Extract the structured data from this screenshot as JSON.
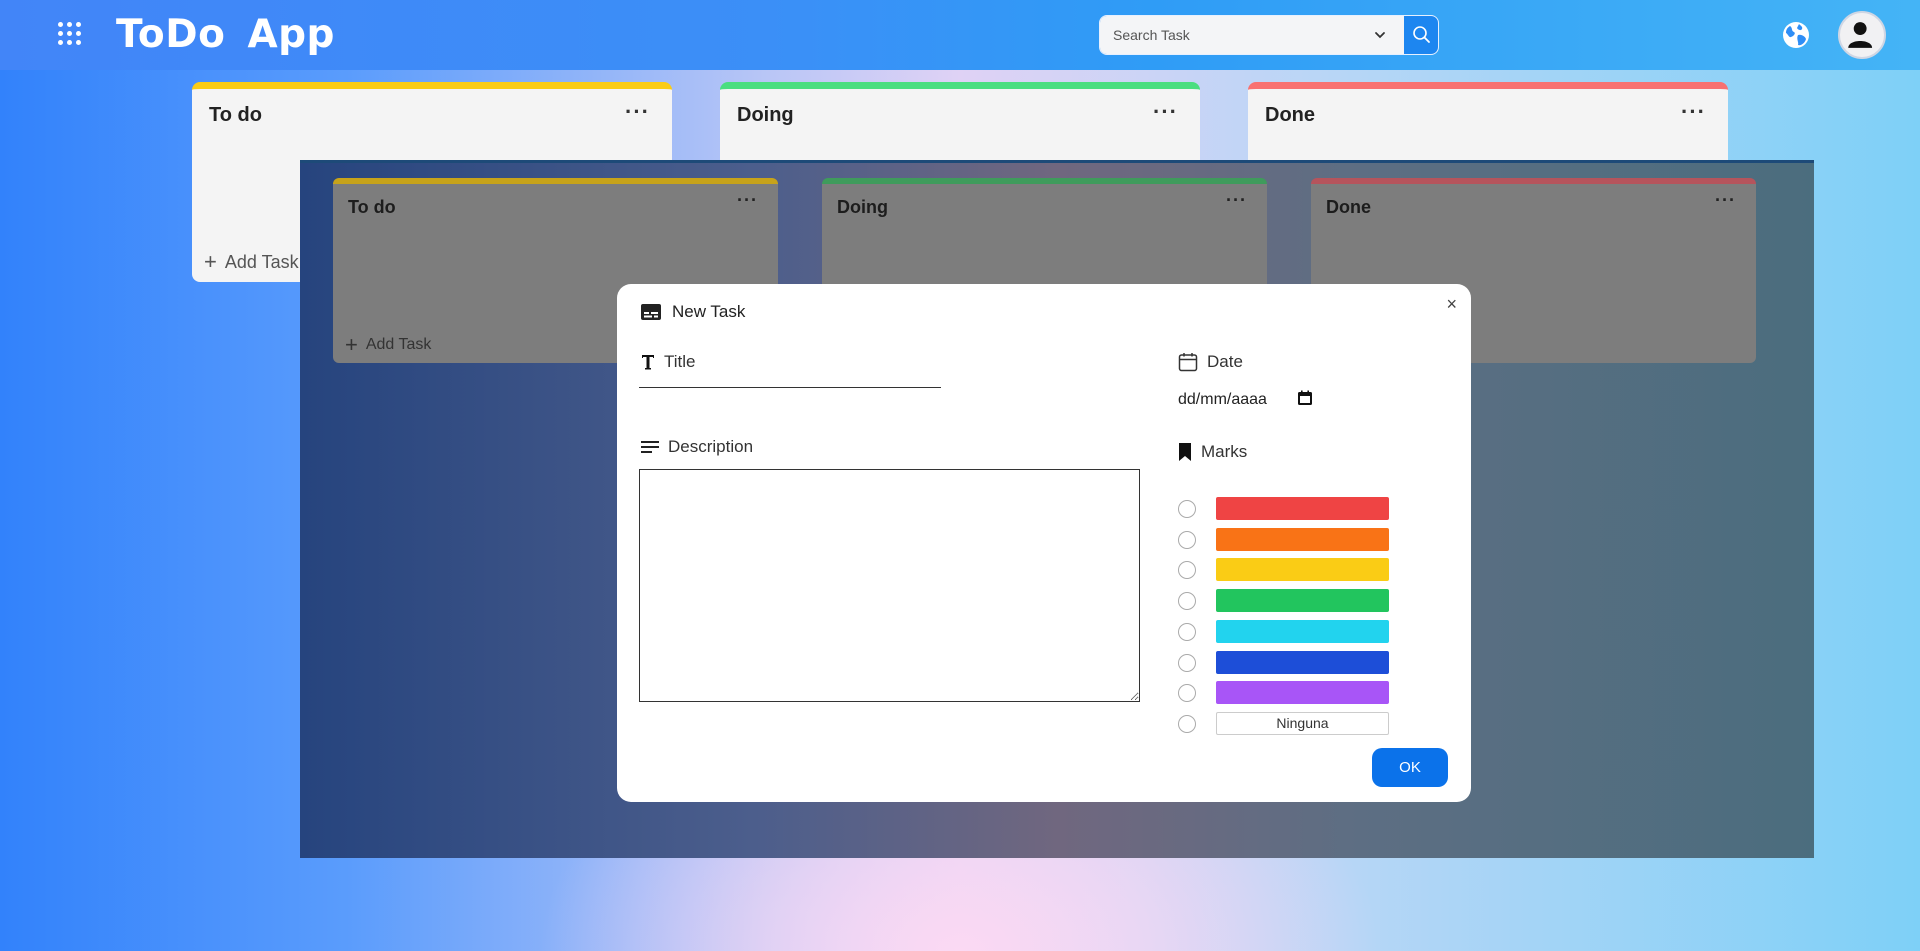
{
  "app": {
    "title": "ToDo App"
  },
  "search": {
    "placeholder": "Search Task"
  },
  "icons": {
    "apps": "apps-grid-icon",
    "chevron": "chevron-down-icon",
    "search": "search-icon",
    "globe": "globe-icon",
    "avatar": "user-avatar-icon",
    "subtitles": "subtitles-icon",
    "title": "text-t-icon",
    "description": "notes-lines-icon",
    "date": "calendar-icon",
    "marks": "bookmark-icon"
  },
  "board": {
    "columns": [
      {
        "title": "To do",
        "accent": "#facc15",
        "menu": "···"
      },
      {
        "title": "Doing",
        "accent": "#4ade80",
        "menu": "···"
      },
      {
        "title": "Done",
        "accent": "#f87171",
        "menu": "···"
      }
    ],
    "add_task_label": "Add Task",
    "add_task_label_cut": "Add Task"
  },
  "overlay_board": {
    "columns": [
      {
        "title": "To do",
        "accent": "#c7a31a",
        "menu": "···"
      },
      {
        "title": "Doing",
        "accent": "#3f9b5c",
        "menu": "···"
      },
      {
        "title": "Done",
        "accent": "#b5545c",
        "menu": "···"
      }
    ],
    "add_task_label": "Add Task"
  },
  "modal": {
    "title": "New Task",
    "close": "×",
    "title_label": "Title",
    "title_value": "",
    "description_label": "Description",
    "description_value": "",
    "date_label": "Date",
    "date_placeholder": "dd/mm/aaaa",
    "marks_label": "Marks",
    "marks": [
      {
        "color": "#ef4444",
        "label": ""
      },
      {
        "color": "#f97316",
        "label": ""
      },
      {
        "color": "#facc15",
        "label": ""
      },
      {
        "color": "#22c55e",
        "label": ""
      },
      {
        "color": "#22d3ee",
        "label": ""
      },
      {
        "color": "#1d4ed8",
        "label": ""
      },
      {
        "color": "#a855f7",
        "label": ""
      },
      {
        "color": "#ffffff",
        "label": "Ninguna"
      }
    ],
    "ok_label": "OK"
  }
}
